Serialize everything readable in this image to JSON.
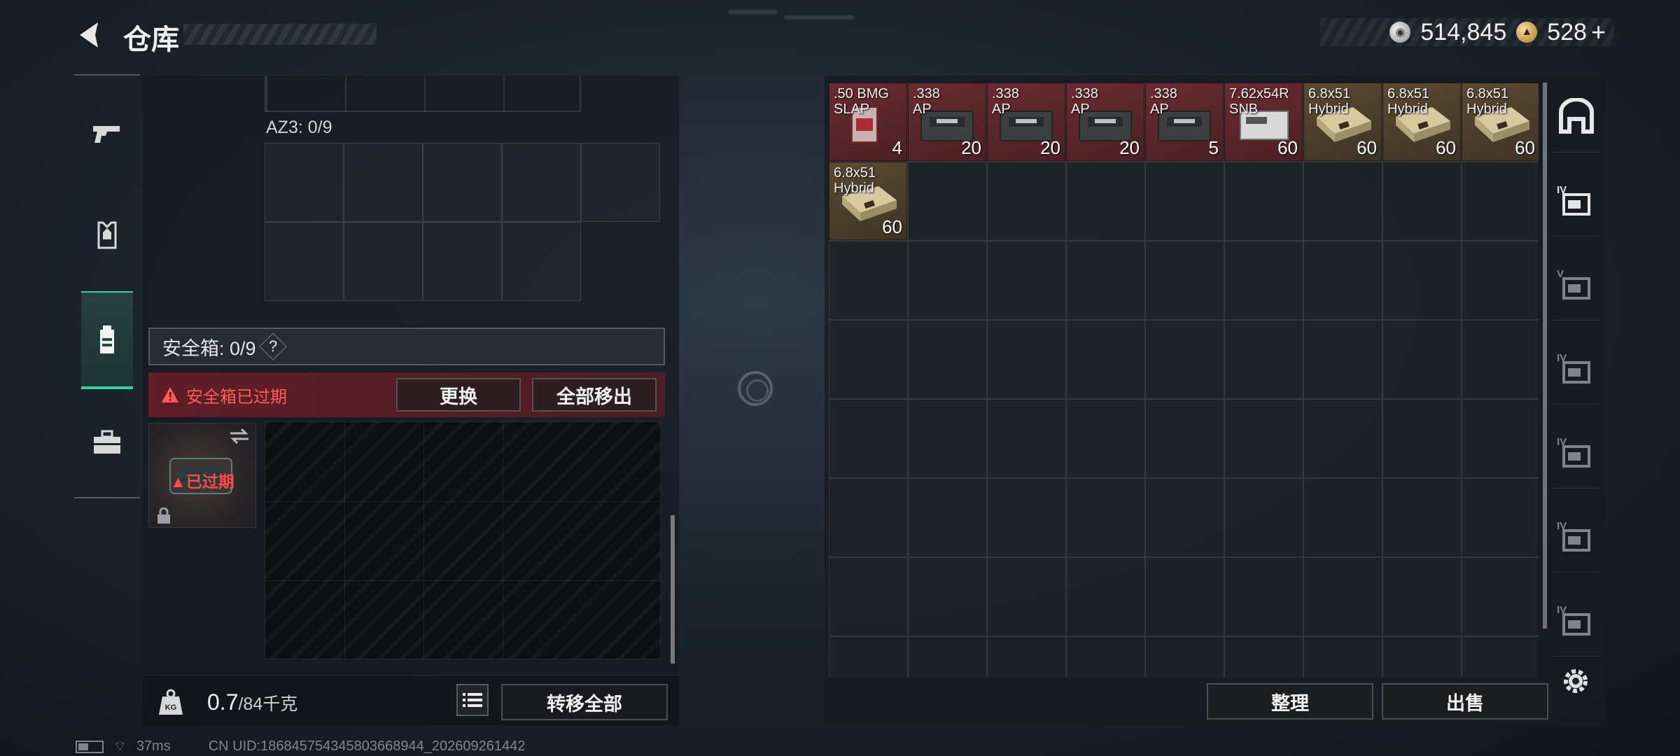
{
  "header": {
    "title": "仓库",
    "currency_silver": "514,845",
    "currency_gold": "528",
    "currency_gold_plus": "+"
  },
  "left_nav": {
    "items": [
      {
        "name": "weapon-tab-icon"
      },
      {
        "name": "armor-tab-icon"
      },
      {
        "name": "backpack-tab-icon",
        "active": true
      },
      {
        "name": "toolbox-tab-icon"
      }
    ]
  },
  "container": {
    "az3_label": "AZ3: 0/9",
    "safe_box_label": "安全箱: 0/9",
    "help_symbol": "?",
    "warning_text": "安全箱已过期",
    "replace_button": "更换",
    "move_all_out_button": "全部移出",
    "expired_label": "已过期"
  },
  "footer_left": {
    "weight_icon_text": "KG",
    "weight_current": "0.7",
    "weight_max": "/84千克",
    "transfer_all_button": "转移全部"
  },
  "footer_right": {
    "organize_button": "整理",
    "sell_button": "出售"
  },
  "stash_items": [
    {
      "name_line1": ".50 BMG",
      "name_line2": "SLAP",
      "count": "4",
      "color": "red"
    },
    {
      "name_line1": ".338",
      "name_line2": "AP",
      "count": "20",
      "color": "red"
    },
    {
      "name_line1": ".338",
      "name_line2": "AP",
      "count": "20",
      "color": "red"
    },
    {
      "name_line1": ".338",
      "name_line2": "AP",
      "count": "20",
      "color": "red"
    },
    {
      "name_line1": ".338",
      "name_line2": "AP",
      "count": "5",
      "color": "red"
    },
    {
      "name_line1": "7.62x54R",
      "name_line2": "SNB",
      "count": "60",
      "color": "red"
    },
    {
      "name_line1": "6.8x51",
      "name_line2": "Hybrid",
      "count": "60",
      "color": "brown"
    },
    {
      "name_line1": "6.8x51",
      "name_line2": "Hybrid",
      "count": "60",
      "color": "brown"
    },
    {
      "name_line1": "6.8x51",
      "name_line2": "Hybrid",
      "count": "60",
      "color": "brown"
    },
    {
      "name_line1": "6.8x51",
      "name_line2": "Hybrid",
      "count": "60",
      "color": "brown"
    }
  ],
  "right_sidebar": {
    "items": [
      {
        "name": "stash-main-icon",
        "label": ""
      },
      {
        "name": "stash-folder-iv-icon",
        "label": "IV"
      },
      {
        "name": "stash-v-icon",
        "label": "V"
      },
      {
        "name": "stash-iv-b-icon",
        "label": "IV"
      },
      {
        "name": "stash-iv-c-icon",
        "label": "IV"
      },
      {
        "name": "stash-iv-add-icon",
        "label": "IV"
      },
      {
        "name": "stash-iv-d-icon",
        "label": "IV"
      }
    ]
  },
  "status": {
    "ping": "37ms",
    "uid": "CN UID:186845754345803668944_202609261442"
  }
}
